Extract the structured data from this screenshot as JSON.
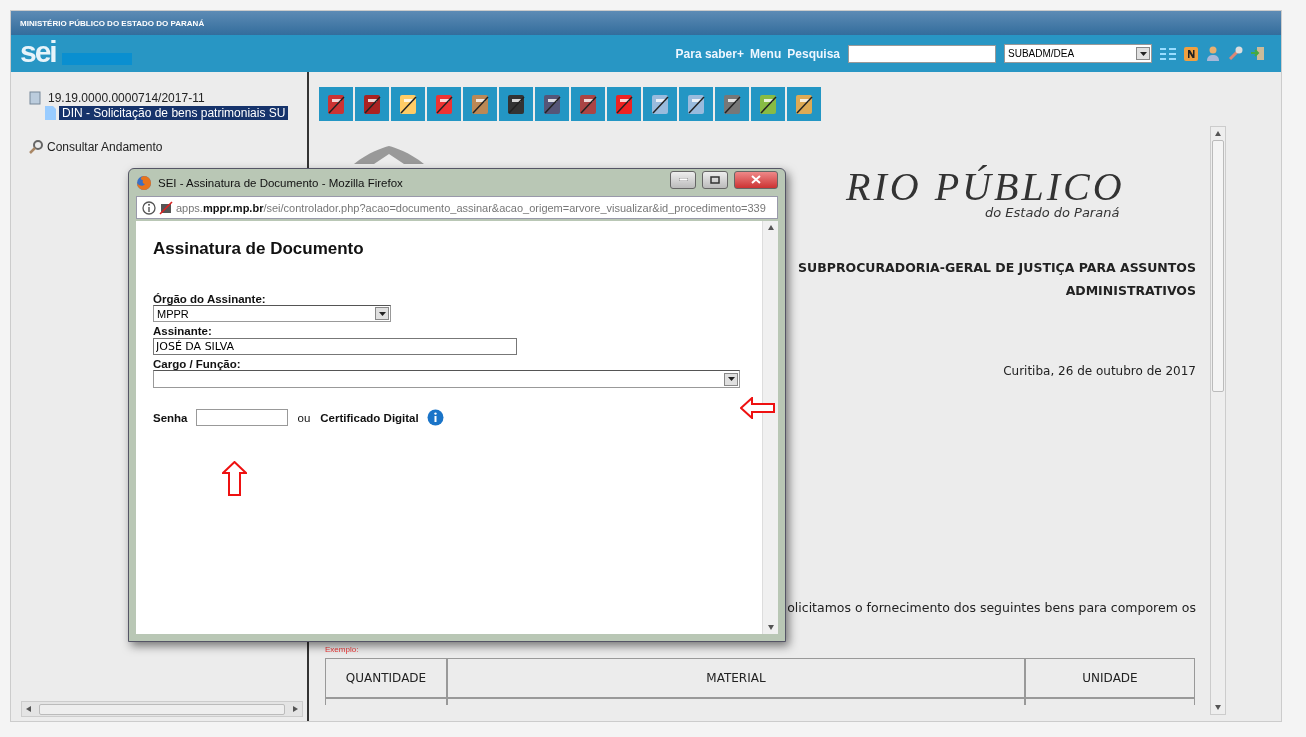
{
  "header": {
    "organization": "MINISTÉRIO PÚBLICO DO ESTADO DO PARANÁ",
    "logo": "sei",
    "links": [
      "Para saber+",
      "Menu",
      "Pesquisa"
    ],
    "unit_select": {
      "value": "SUBADM/DEA"
    }
  },
  "tree": [
    {
      "label": "19.19.0000.0000714/2017-11",
      "selected": false,
      "children": [
        {
          "label": "DIN - Solicitação de bens patrimoniais SU",
          "selected": true
        }
      ]
    }
  ],
  "consult_link": "Consultar Andamento",
  "document": {
    "title": "RIO PÚBLICO",
    "subtitle": "do Estado do Paraná",
    "heading_lines": [
      "SUBPROCURADORIA-GERAL DE JUSTIÇA PARA ASSUNTOS",
      "ADMINISTRATIVOS"
    ],
    "date": "Curitiba, 26 de outubro de 2017",
    "body": "olicitamos o fornecimento dos seguintes bens para comporem os",
    "example_label": "Exemplo:",
    "table": {
      "columns": [
        "QUANTIDADE",
        "MATERIAL",
        "UNIDADE"
      ]
    }
  },
  "popup": {
    "title": "SEI - Assinatura de Documento - Mozilla Firefox",
    "url": "apps.**mppr.mp.br**/sei/controlador.php?acao=documento_assinar&acao_origem=arvore_visualizar&id_procedimento=339",
    "heading": "Assinatura de Documento",
    "orgao": {
      "label": "Órgão do Assinante:",
      "value": "MPPR"
    },
    "assinante": {
      "label": "Assinante:",
      "value": "JOSÉ DA SILVA"
    },
    "cargo": {
      "label": "Cargo / Função:"
    },
    "senha": {
      "label": "Senha"
    },
    "or": "ou",
    "certificate": "Certificado Digital"
  }
}
